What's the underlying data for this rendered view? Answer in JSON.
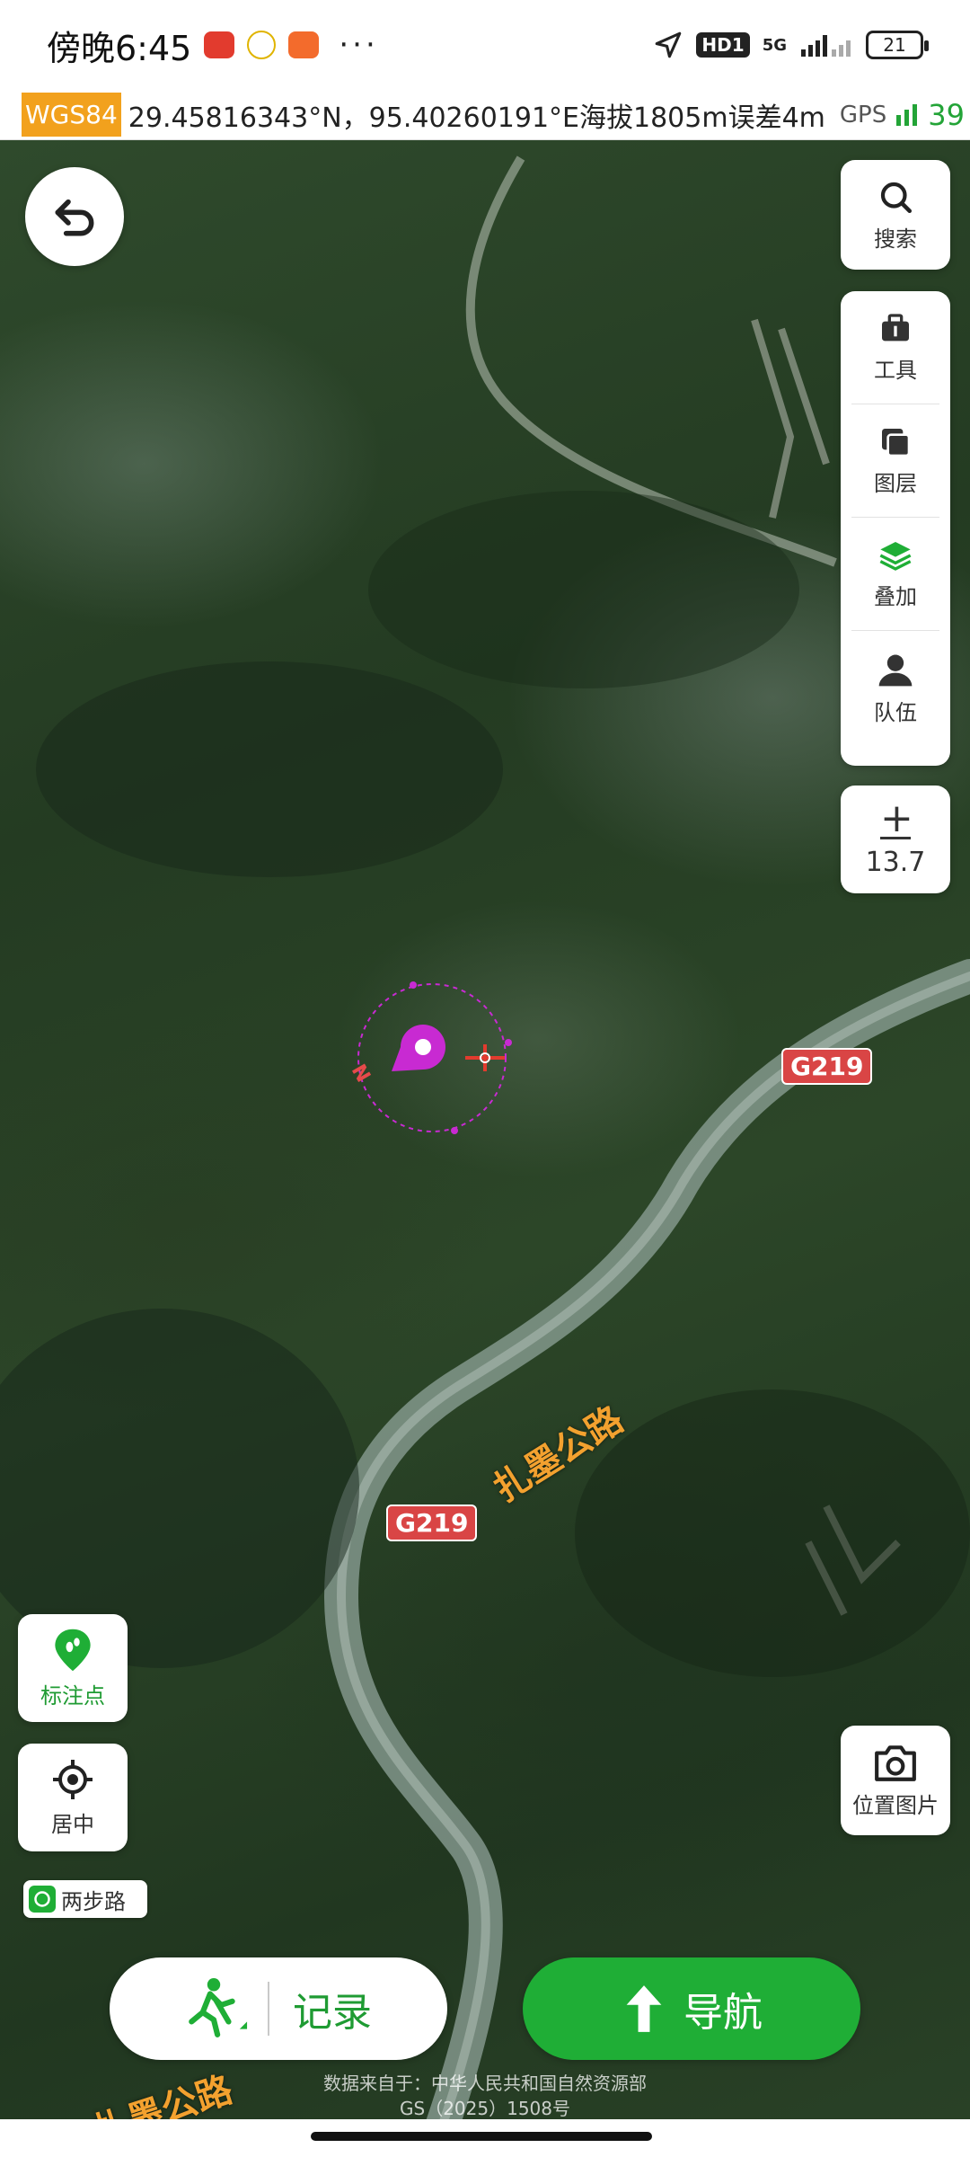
{
  "status_bar": {
    "time": "傍晚6:45",
    "more": "···",
    "network_badge": "HD1",
    "signal": "5G",
    "battery": "21"
  },
  "coord_bar": {
    "datum": "WGS84",
    "coordinates": "29.45816343°N，95.40260191°E海拔1805m误差4m",
    "gps_label": "GPS",
    "gps_count": "39"
  },
  "toolbar": {
    "search_label": "搜索",
    "tools_label": "工具",
    "layers_label": "图层",
    "overlay_label": "叠加",
    "team_label": "队伍"
  },
  "zoom": {
    "symbol": "+",
    "level": "13.7"
  },
  "map": {
    "roads": [
      {
        "code": "G219"
      },
      {
        "code": "G219"
      }
    ],
    "road_names": [
      "扎墨公路",
      "扎墨公路"
    ],
    "compass": "N"
  },
  "left_buttons": {
    "mark_label": "标注点",
    "center_label": "居中"
  },
  "right_buttons": {
    "photo_label": "位置图片"
  },
  "brand_tag": "两步路",
  "bottom": {
    "record_label": "记录",
    "navigate_label": "导航"
  },
  "copyright": {
    "line1": "数据来自于：中华人民共和国自然资源部",
    "line2": "GS（2025）1508号"
  },
  "colors": {
    "accent_green": "#1fae36",
    "datum_orange": "#f2a11d",
    "road_red": "#d94545",
    "location_pin": "#c82ad2"
  }
}
